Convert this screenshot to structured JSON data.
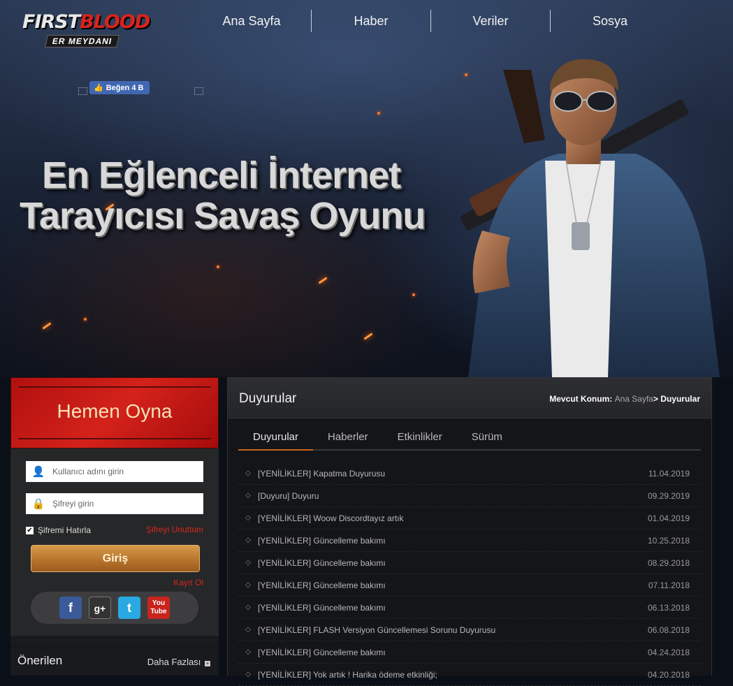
{
  "brand": {
    "line1_a": "FIRST",
    "line1_b": "BLOOD",
    "line2": "ER MEYDANI"
  },
  "nav": [
    "Ana Sayfa",
    "Haber",
    "Veriler",
    "Sosya"
  ],
  "facebook": {
    "like_label": "Beğen 4 B"
  },
  "hero": {
    "slogan_line1": "En Eğlenceli İnternet",
    "slogan_line2": "Tarayıcısı Savaş Oyunu"
  },
  "play_banner": {
    "label": "Hemen Oyna"
  },
  "login": {
    "username_placeholder": "Kullanıcı adını girin",
    "password_placeholder": "Şifreyi girin",
    "remember_label": "Şifremi Hatırla",
    "remember_checked": true,
    "forgot_label": "Şifreyi Unuttum",
    "submit_label": "Giriş",
    "register_label": "Kayıt Ol"
  },
  "social": [
    {
      "icon": "facebook-icon",
      "glyph": "f"
    },
    {
      "icon": "google-plus-icon",
      "glyph": "g+"
    },
    {
      "icon": "twitter-icon",
      "glyph": "t"
    },
    {
      "icon": "youtube-icon",
      "glyph": "You Tube"
    }
  ],
  "recommended": {
    "title": "Önerilen",
    "more_label": "Daha Fazlası"
  },
  "announcements": {
    "title": "Duyurular",
    "breadcrumb": {
      "prefix": "Mevcut Konum:",
      "home": "Ana Sayfa",
      "current": "> Duyurular"
    },
    "tabs": [
      "Duyurular",
      "Haberler",
      "Etkinlikler",
      "Sürüm"
    ],
    "active_tab": 0,
    "items": [
      {
        "title": "[YENİLİKLER] Kapatma Duyurusu",
        "date": "11.04.2019"
      },
      {
        "title": "[Duyuru] Duyuru",
        "date": "09.29.2019"
      },
      {
        "title": "[YENİLİKLER] Woow Discordtayız artık",
        "date": "01.04.2019"
      },
      {
        "title": "[YENİLİKLER] Güncelleme bakımı",
        "date": "10.25.2018"
      },
      {
        "title": "[YENİLİKLER] Güncelleme bakımı",
        "date": "08.29.2018"
      },
      {
        "title": "[YENİLİKLER] Güncelleme bakımı",
        "date": "07.11.2018"
      },
      {
        "title": "[YENİLİKLER] Güncelleme bakımı",
        "date": "06.13.2018"
      },
      {
        "title": "[YENİLİKLER] FLASH Versiyon Güncellemesi Sorunu Duyurusu",
        "date": "06.08.2018"
      },
      {
        "title": "[YENİLİKLER] Güncelleme bakımı",
        "date": "04.24.2018"
      },
      {
        "title": "[YENİLİKLER] Yok artık ! Harika ödeme etkinliği;",
        "date": "04.20.2018"
      }
    ]
  },
  "colors": {
    "accent_red": "#d6281f",
    "tab_underline": "#c5641c",
    "login_button": "#b8742c"
  }
}
